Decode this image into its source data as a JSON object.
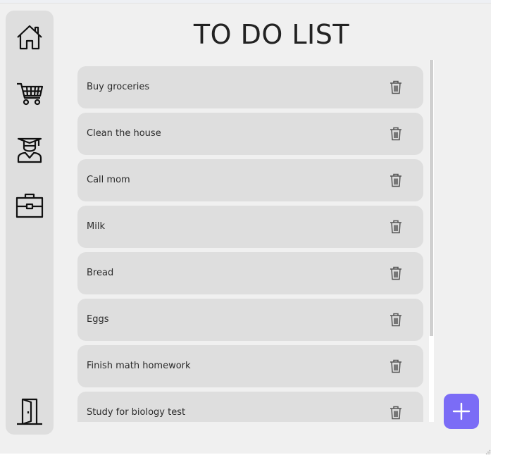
{
  "app": {
    "title": "TO DO LIST"
  },
  "sidebar": {
    "items": [
      {
        "icon": "home-icon"
      },
      {
        "icon": "shopping-cart-icon"
      },
      {
        "icon": "graduate-icon"
      },
      {
        "icon": "briefcase-icon"
      }
    ],
    "exit_icon": "exit-door-icon"
  },
  "tasks": [
    {
      "label": "Buy groceries"
    },
    {
      "label": "Clean the house"
    },
    {
      "label": "Call mom"
    },
    {
      "label": "Milk"
    },
    {
      "label": "Bread"
    },
    {
      "label": "Eggs"
    },
    {
      "label": "Finish math homework"
    },
    {
      "label": "Study for biology test"
    }
  ],
  "add_button": {
    "icon": "plus-icon",
    "color": "#7b6cf6"
  },
  "colors": {
    "background": "#f0f0f0",
    "panel": "#dedede",
    "text": "#222222"
  }
}
